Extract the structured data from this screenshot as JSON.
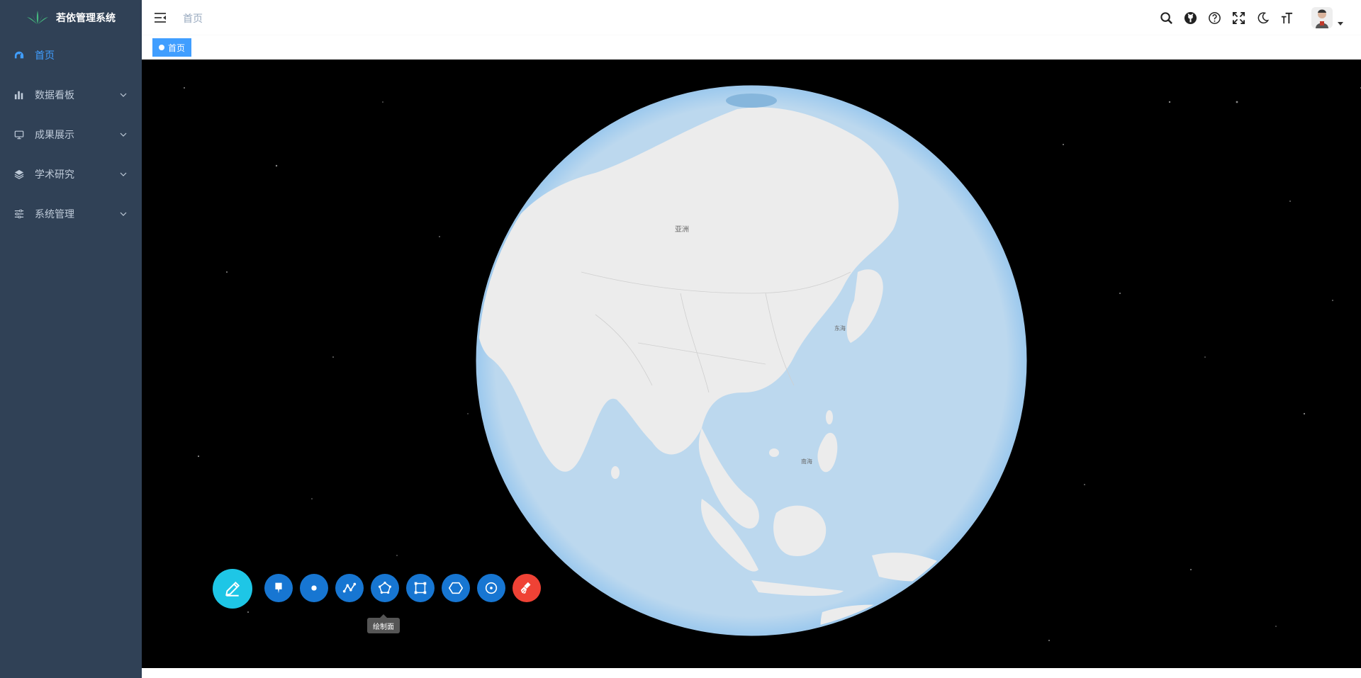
{
  "app": {
    "title": "若依管理系统"
  },
  "sidebar": {
    "items": [
      {
        "label": "首页",
        "icon": "dashboard-icon",
        "active": true
      },
      {
        "label": "数据看板",
        "icon": "bar-chart-icon"
      },
      {
        "label": "成果展示",
        "icon": "monitor-icon"
      },
      {
        "label": "学术研究",
        "icon": "layers-icon"
      },
      {
        "label": "系统管理",
        "icon": "settings-sliders-icon"
      }
    ]
  },
  "header": {
    "breadcrumb": "首页",
    "tools": [
      "search-icon",
      "github-icon",
      "help-icon",
      "fullscreen-icon",
      "dark-mode-icon",
      "font-size-icon"
    ]
  },
  "tags": [
    {
      "label": "首页",
      "active": true
    }
  ],
  "map": {
    "labels": {
      "asia": "亚洲",
      "east_china_sea": "东海",
      "south_china_sea": "南海"
    }
  },
  "draw_toolbar": {
    "main_icon": "pencil-icon",
    "buttons": [
      "marker-icon",
      "point-icon",
      "polyline-icon",
      "polygon-icon",
      "rectangle-icon",
      "hexagon-icon",
      "circle-icon",
      "eraser-icon"
    ],
    "tooltip": "绘制面"
  },
  "colors": {
    "sidebar_bg": "#304156",
    "accent": "#409eff",
    "draw_main": "#1ec6e6",
    "draw_button": "#1776d2",
    "draw_clear": "#ef4235",
    "ocean": "#bcd8ee",
    "land": "#ececec"
  }
}
